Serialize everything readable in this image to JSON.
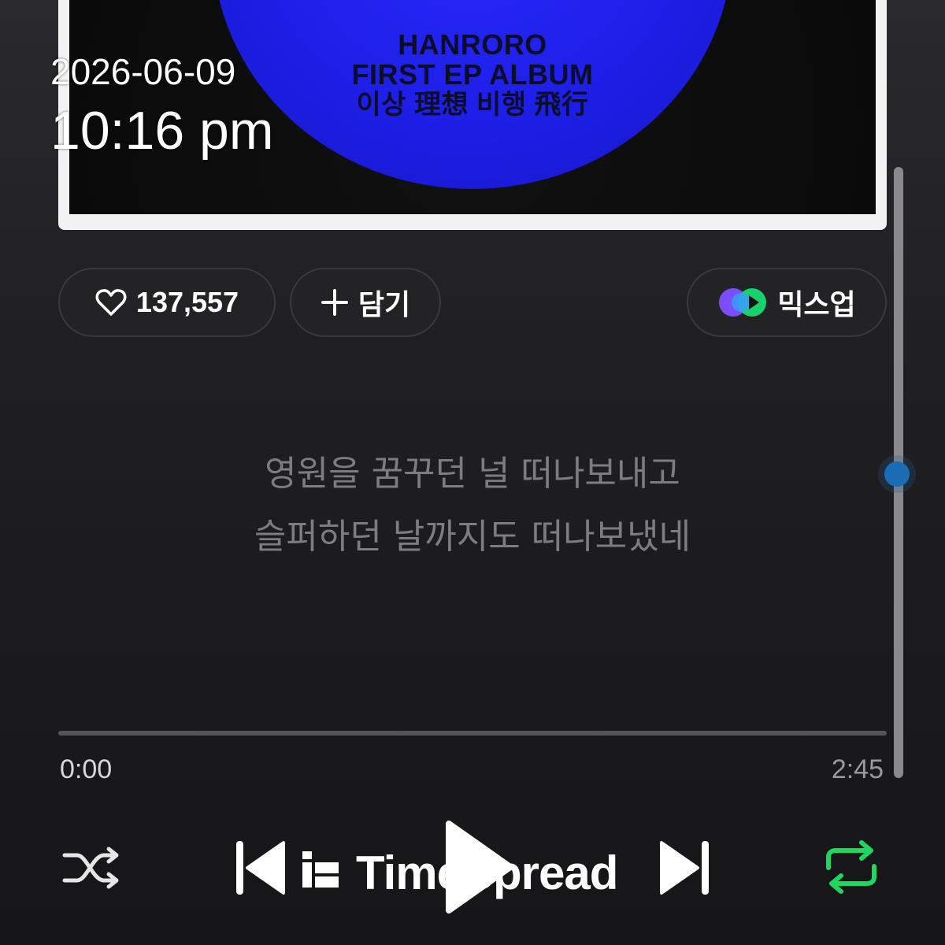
{
  "album": {
    "artist_line": "HANROROFIRST EP ALBUM",
    "title_line1": "HANRORO",
    "title_line2": "FIRST EP ALBUM",
    "title_line3": "이상 理想 비행 飛行"
  },
  "timestamp": {
    "date": "2026-06-09",
    "time": "10:16 pm"
  },
  "actions": {
    "like_count": "137,557",
    "add_label": "담기",
    "mixup_label": "믹스업"
  },
  "lyrics": {
    "line1": "영원을 꿈꾸던 널 떠나보내고",
    "line2": "슬퍼하던 날까지도 떠나보냈네"
  },
  "player": {
    "current_time": "0:00",
    "total_time": "2:45",
    "progress_fraction": 0,
    "repeat_color": "#1ed760"
  },
  "watermark": {
    "text": "TimeSpread"
  },
  "icons": {
    "like": "heart-icon",
    "add": "plus-icon",
    "mixup": "mixup-icon",
    "shuffle": "shuffle-icon",
    "prev": "skip-previous-icon",
    "play": "play-icon",
    "next": "skip-next-icon",
    "repeat": "repeat-icon"
  }
}
